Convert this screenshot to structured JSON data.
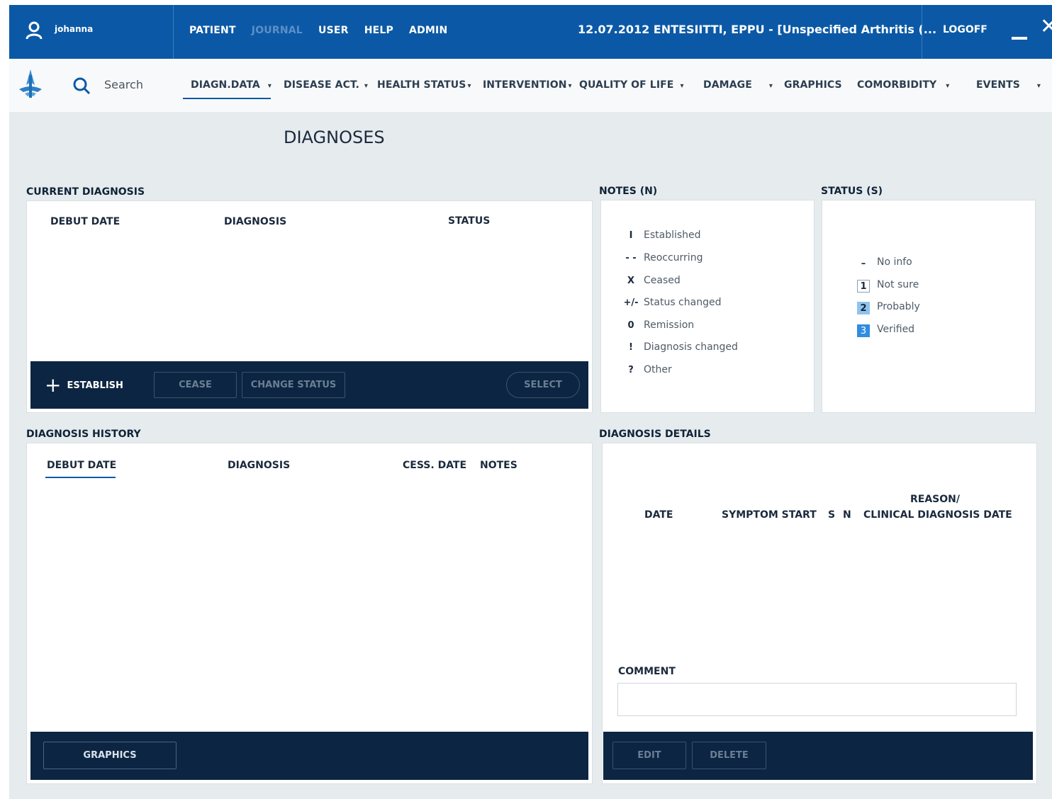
{
  "topbar": {
    "user_icon": "user-icon",
    "username": "johanna",
    "menu": {
      "patient": "PATIENT",
      "journal": "JOURNAL",
      "user": "USER",
      "help": "HELP",
      "admin": "ADMIN"
    },
    "patient_info": "12.07.2012 ENTESIITTI, EPPU - [Unspecified Arthritis (...",
    "logoff": "LOGOFF",
    "close_glyph": "✕"
  },
  "nav": {
    "logo": "app-logo",
    "search": {
      "icon": "search-icon",
      "placeholder": "Search"
    },
    "items": [
      {
        "label": "DIAGN.DATA",
        "caret": "▾"
      },
      {
        "label": "DISEASE ACT.",
        "caret": "▾"
      },
      {
        "label": "HEALTH STATUS",
        "caret": "▾"
      },
      {
        "label": "INTERVENTION",
        "caret": "▾"
      },
      {
        "label": "QUALITY OF LIFE",
        "caret": "▾"
      },
      {
        "label": "DAMAGE",
        "caret": "▾"
      },
      {
        "label": "GRAPHICS",
        "caret": ""
      },
      {
        "label": "COMORBIDITY",
        "caret": "▾"
      },
      {
        "label": "EVENTS",
        "caret": "▾"
      }
    ]
  },
  "page_title": "DIAGNOSES",
  "current_diagnosis": {
    "label": "CURRENT DIAGNOSIS",
    "columns": [
      "DEBUT DATE",
      "DIAGNOSIS",
      "STATUS"
    ],
    "buttons": {
      "establish": "ESTABLISH",
      "cease": "CEASE",
      "change_status": "CHANGE STATUS",
      "select": "SELECT"
    }
  },
  "notes": {
    "label": "NOTES (N)",
    "items": [
      {
        "symbol": "I",
        "text": "Established"
      },
      {
        "symbol": "- -",
        "text": "Reoccurring"
      },
      {
        "symbol": "X",
        "text": "Ceased"
      },
      {
        "symbol": "+/-",
        "text": "Status changed"
      },
      {
        "symbol": "0",
        "text": "Remission"
      },
      {
        "symbol": "!",
        "text": "Diagnosis changed"
      },
      {
        "symbol": "?",
        "text": "Other"
      }
    ]
  },
  "status": {
    "label": "STATUS (S)",
    "items": [
      {
        "symbol": "–",
        "text": "No info"
      },
      {
        "symbol": "1",
        "text": "Not sure"
      },
      {
        "symbol": "2",
        "text": "Probably"
      },
      {
        "symbol": "3",
        "text": "Verified"
      }
    ],
    "colors": {
      "probably": "#8fc3ee",
      "verified": "#2f8de0"
    }
  },
  "history": {
    "label": "DIAGNOSIS HISTORY",
    "columns": [
      "DEBUT DATE",
      "DIAGNOSIS",
      "CESS. DATE",
      "NOTES"
    ],
    "graphics_button": "GRAPHICS"
  },
  "details": {
    "label": "DIAGNOSIS DETAILS",
    "columns": {
      "date": "DATE",
      "symptom_start": "SYMPTOM START",
      "s": "S",
      "n": "N",
      "reason_line1": "REASON/",
      "reason_line2": "CLINICAL DIAGNOSIS DATE"
    },
    "comment_label": "COMMENT",
    "comment_value": "",
    "buttons": {
      "edit": "EDIT",
      "delete": "DELETE"
    }
  },
  "colors": {
    "topbar": "#0b59a6",
    "toolbar": "#0c2542",
    "background": "#e6ebee"
  }
}
